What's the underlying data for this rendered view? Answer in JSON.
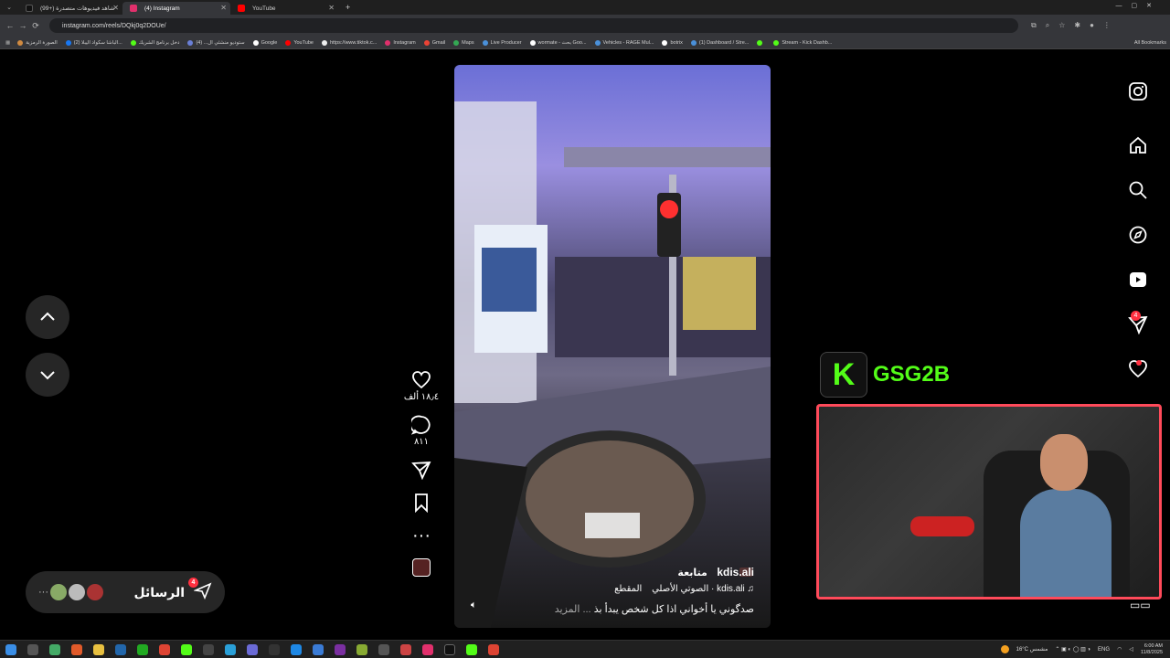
{
  "browser": {
    "tabs": [
      {
        "title": "(99+) شاهد فيديوهات متصدرة",
        "favicon_color": "#111111",
        "active": false
      },
      {
        "title": "(4) Instagram",
        "favicon_color": "#e1306c",
        "active": true
      },
      {
        "title": "YouTube",
        "favicon_color": "#ff0000",
        "active": false
      }
    ],
    "new_tab": "+",
    "url": "instagram.com/reels/DQkj0q2DOUe/",
    "bookmarks": [
      {
        "label": "الصورة الرمزية",
        "color": "#d08a40"
      },
      {
        "label": "(2) الباشا سكواد اليبلا...",
        "color": "#1877f2"
      },
      {
        "label": "دخل برنامج الشريك",
        "color": "#53fc18"
      },
      {
        "label": "ستوديو منشئي ال... (4)",
        "color": "#6a7fd6"
      },
      {
        "label": "Google",
        "color": "#ffffff"
      },
      {
        "label": "YouTube",
        "color": "#ff0000"
      },
      {
        "label": "https://www.tiktok.c...",
        "color": "#eeeeee"
      },
      {
        "label": "Instagram",
        "color": "#e1306c"
      },
      {
        "label": "Gmail",
        "color": "#ea4335"
      },
      {
        "label": "Maps",
        "color": "#34a853"
      },
      {
        "label": "Live Producer",
        "color": "#4a90d9"
      },
      {
        "label": "wormate - بحث Goo...",
        "color": "#ffffff"
      },
      {
        "label": "Vehicles - RAGE Mul...",
        "color": "#4a90d9"
      },
      {
        "label": "botrix",
        "color": "#ffffff"
      },
      {
        "label": "(1) Dashboard / Stre...",
        "color": "#4a90d9"
      },
      {
        "label": "",
        "color": "#53fc18"
      },
      {
        "label": "Stream - Kick Dashb...",
        "color": "#53fc18"
      }
    ],
    "all_bookmarks": "All Bookmarks"
  },
  "reel": {
    "username": "kdis.ali",
    "follow_label": "متابعة",
    "audio": "kdis.ali · الصوتي الأصلي",
    "clip_label": "المقطع",
    "caption": "صدگوني يا أخواني اذا كل شخص يبدأ بذ",
    "more_label": "... المزيد"
  },
  "actions": {
    "likes": "١٨٫٤ ألف",
    "comments": "٨١١"
  },
  "messages": {
    "label": "الرسائل",
    "badge": "4",
    "more": "···"
  },
  "rail": {
    "badge": "4"
  },
  "overlay": {
    "kick_letter": "K",
    "channel": "GSG2B",
    "kick_color": "#53fc18",
    "frame_color": "#ff4a5a"
  },
  "taskbar": {
    "weather": "16°C مشمس",
    "lang": "ENG",
    "time": "6:00 AM",
    "date": "11/8/2025"
  }
}
